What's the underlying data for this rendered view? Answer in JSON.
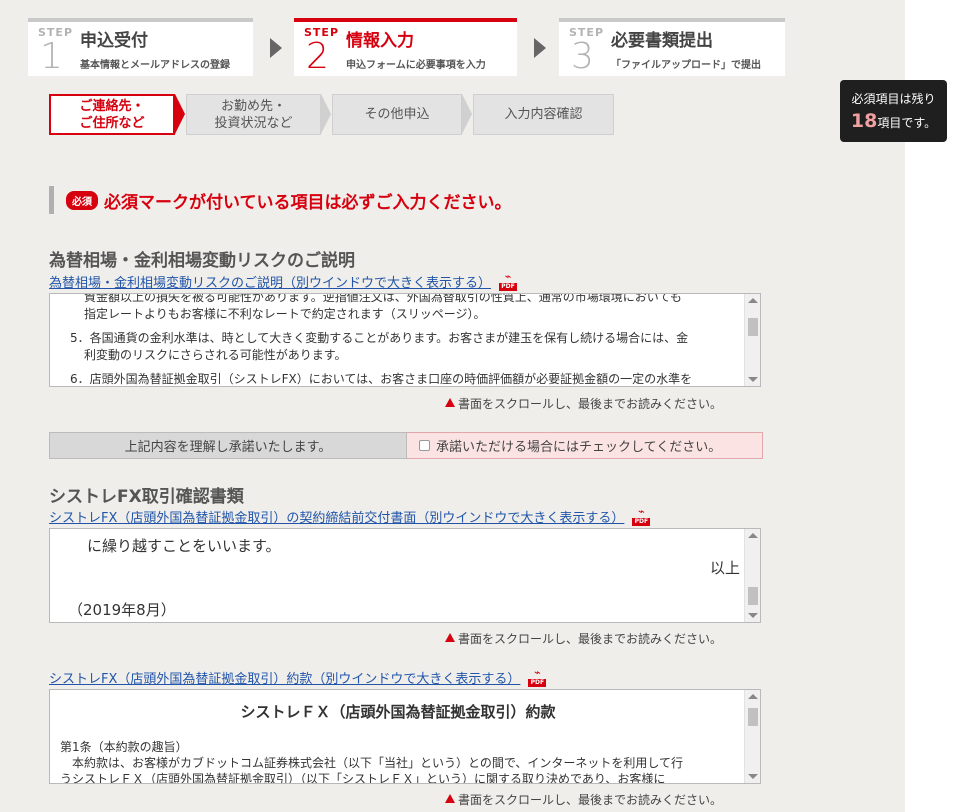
{
  "steps": [
    {
      "word": "STEP",
      "num": "1",
      "title": "申込受付",
      "sub": "基本情報とメールアドレスの登録"
    },
    {
      "word": "STEP",
      "num": "2",
      "title": "情報入力",
      "sub": "申込フォームに必要事項を入力"
    },
    {
      "word": "STEP",
      "num": "3",
      "title": "必要書類提出",
      "sub": "「ファイルアップロード」で提出"
    }
  ],
  "subtabs": [
    {
      "l1": "ご連絡先・",
      "l2": "ご住所など"
    },
    {
      "l1": "お勤め先・",
      "l2": "投資状況など"
    },
    {
      "l1": "その他申込",
      "l2": ""
    },
    {
      "l1": "入力内容確認",
      "l2": ""
    }
  ],
  "badge": {
    "line1": "必須項目は残り",
    "count": "18",
    "suffix": "項目です。"
  },
  "notice": {
    "tag": "必須",
    "text": "必須マークが付いている項目は必ずご入力ください。"
  },
  "section1": {
    "title": "為替相場・金利相場変動リスクのご説明",
    "link": "為替相場・金利相場変動リスクのご説明（別ウインドウで大きく表示する）",
    "lines": [
      "資金額以上の損失を被る可能性があります。逆指値注文は、外国為替取引の性質上、通常の市場環境においても",
      "指定レートよりもお客様に不利なレートで約定されます（スリッページ）。",
      "5．各国通貨の金利水準は、時として大きく変動することがあります。お客さまが建玉を保有し続ける場合には、金",
      "利変動のリスクにさらされる可能性があります。",
      "6．店頭外国為替証拠金取引（シストレFX）においては、お客さま口座の時価評価額が必要証拠金額の一定の水準を"
    ],
    "note": "書面をスクロールし、最後までお読みください。",
    "agree_left": "上記内容を理解し承諾いたします。",
    "agree_right": "承諾いただける場合にはチェックしてください。"
  },
  "section2": {
    "title": "シストレFX取引確認書類",
    "link1": "シストレFX（店頭外国為替証拠金取引）の契約締結前交付書面（別ウインドウで大きく表示する）",
    "box1": {
      "line1": "に繰り越すことをいいます。",
      "right": "以上",
      "date": "（2019年8月）"
    },
    "note1": "書面をスクロールし、最後までお読みください。",
    "link2": "シストレFX（店頭外国為替証拠金取引）約款（別ウインドウで大きく表示する）",
    "box2": {
      "heading": "シストレＦＸ（店頭外国為替証拠金取引）約款",
      "article": "第1条（本約款の趣旨）",
      "body1": "本約款は、お客様がカブドットコム証券株式会社（以下「当社」という）との間で、インターネットを利用して行",
      "body2": "うシストレＦＸ（店頭外国為替証拠金取引）（以下「シストレＦＸ」という）に関する取り決めであり、お客様に"
    },
    "note2": "書面をスクロールし、最後までお読みください。"
  },
  "icons": {
    "pdf": "pdf-icon",
    "warning": "warning-icon",
    "arrow": "arrow-right-icon"
  },
  "colors": {
    "accent": "#d7000f",
    "link": "#2255aa",
    "bg": "#efeeea"
  }
}
